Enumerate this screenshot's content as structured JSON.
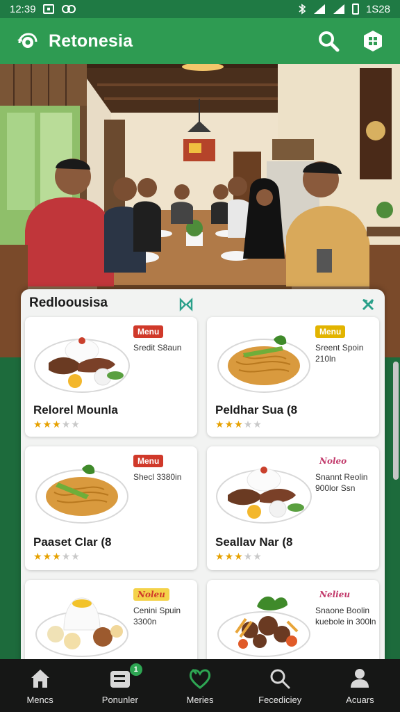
{
  "status": {
    "time": "12:39",
    "right_text": "1S28"
  },
  "app": {
    "title": "Retonesia"
  },
  "section": {
    "title": "Redloousisa"
  },
  "cards": [
    {
      "name": "Relorel Mounla",
      "badge": "Menu",
      "badge_style": "red",
      "desc": "Sredit S8aun",
      "rating": 3,
      "dish": "rice-plate"
    },
    {
      "name": "Peldhar Sua (8",
      "badge": "Menu",
      "badge_style": "yellow",
      "desc": "Sreent Spoin 210ln",
      "rating": 3,
      "dish": "noodles"
    },
    {
      "name": "Paaset Clar (8",
      "badge": "Menu",
      "badge_style": "red",
      "desc": "Shecl 3380in",
      "rating": 3,
      "dish": "noodles"
    },
    {
      "name": "Seallav Nar (8",
      "badge": "Noleo",
      "badge_style": "script",
      "desc": "Snannt Reolin 900lor Ssn",
      "rating": 3,
      "dish": "rice-plate"
    },
    {
      "name": "",
      "badge": "Noleu",
      "badge_style": "script box",
      "desc": "Cenini Spuin 3300n",
      "rating": 0,
      "dish": "rice-dome"
    },
    {
      "name": "",
      "badge": "Nelieu",
      "badge_style": "script",
      "desc": "Snaone Boolin kuebole in 300ln",
      "rating": 0,
      "dish": "meat-plate"
    }
  ],
  "nav": [
    {
      "label": "Mencs",
      "icon": "home-icon"
    },
    {
      "label": "Ponunler",
      "icon": "list-icon",
      "badge": "1"
    },
    {
      "label": "Meries",
      "icon": "heart-icon"
    },
    {
      "label": "Fecediciey",
      "icon": "search-icon"
    },
    {
      "label": "Acuars",
      "icon": "person-icon"
    }
  ],
  "colors": {
    "appbar": "#2e9b52",
    "statusbar": "#1f7a44",
    "accent": "#2ea653",
    "nav_bg": "#161716"
  }
}
